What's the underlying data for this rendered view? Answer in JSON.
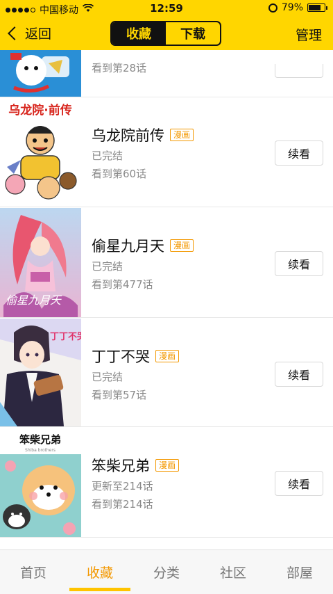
{
  "status_bar": {
    "carrier": "中国移动",
    "time": "12:59",
    "battery": "79%",
    "battery_level": 0.79
  },
  "nav": {
    "back_label": "返回",
    "segments": [
      "收藏",
      "下载"
    ],
    "active_segment": 0,
    "manage_label": "管理"
  },
  "list": [
    {
      "title": "",
      "badge": "",
      "status": "",
      "progress": "看到第28话",
      "continue_label": "",
      "cover_label": ""
    },
    {
      "title": "乌龙院前传",
      "badge": "漫画",
      "status": "已完结",
      "progress": "看到第60话",
      "continue_label": "续看",
      "cover_label": "乌龙院·前传"
    },
    {
      "title": "偷星九月天",
      "badge": "漫画",
      "status": "已完结",
      "progress": "看到第477话",
      "continue_label": "续看",
      "cover_label": "偷星九月天"
    },
    {
      "title": "丁丁不哭",
      "badge": "漫画",
      "status": "已完结",
      "progress": "看到第57话",
      "continue_label": "续看",
      "cover_label": "丁丁不哭"
    },
    {
      "title": "笨柴兄弟",
      "badge": "漫画",
      "status": "更新至214话",
      "progress": "看到第214话",
      "continue_label": "续看",
      "cover_label": "笨柴兄弟",
      "cover_sublabel": "Shiba brothers"
    }
  ],
  "tab_bar": {
    "tabs": [
      "首页",
      "收藏",
      "分类",
      "社区",
      "部屋"
    ],
    "active_tab": 1
  },
  "colors": {
    "brand_yellow": "#ffd600",
    "accent_orange": "#f39800",
    "tab_indicator": "#ffc400"
  }
}
